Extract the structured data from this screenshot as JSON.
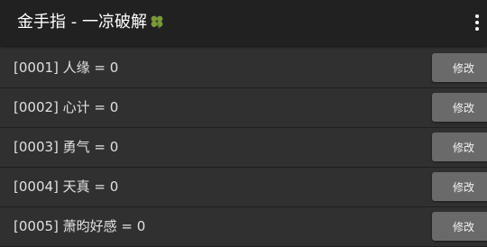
{
  "app_bar": {
    "title": "金手指 - 一凉破解",
    "title_icon": "four-leaf-clover-icon",
    "menu_icon": "overflow-menu-icon"
  },
  "rows": [
    {
      "label": "[0001] 人缘 = 0",
      "button": "修改"
    },
    {
      "label": "[0002] 心计 = 0",
      "button": "修改"
    },
    {
      "label": "[0003] 勇气 = 0",
      "button": "修改"
    },
    {
      "label": "[0004] 天真 = 0",
      "button": "修改"
    },
    {
      "label": "[0005] 萧昀好感 = 0",
      "button": "修改"
    }
  ],
  "colors": {
    "app_bar": "#212121",
    "background": "#303030",
    "button": "#6a6a6a",
    "clover": "#7a9a3a"
  }
}
